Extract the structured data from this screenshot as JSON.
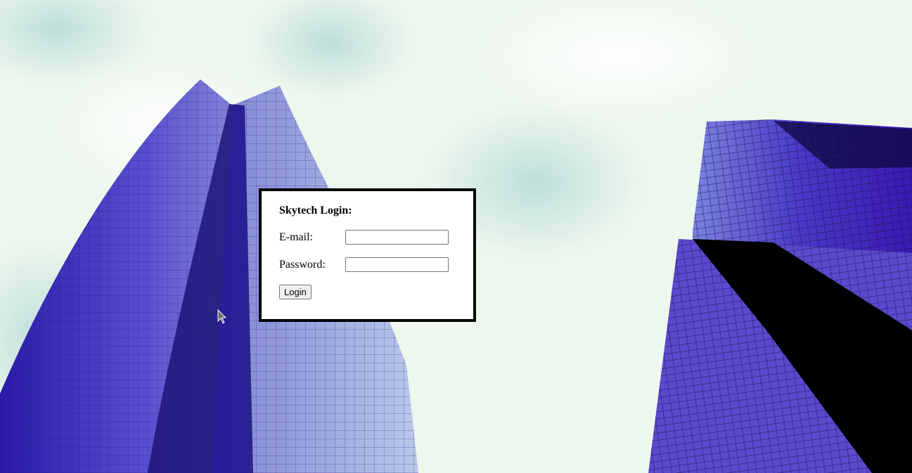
{
  "background": {
    "sky_color": "#eef7ee",
    "building_color": "#3b2bb8"
  },
  "login": {
    "title": "Skytech Login:",
    "email_label": "E-mail:",
    "email_value": "",
    "password_label": "Password:",
    "password_value": "",
    "button_label": "Login"
  },
  "cursor": {
    "icon": "arrow-cursor-icon"
  }
}
